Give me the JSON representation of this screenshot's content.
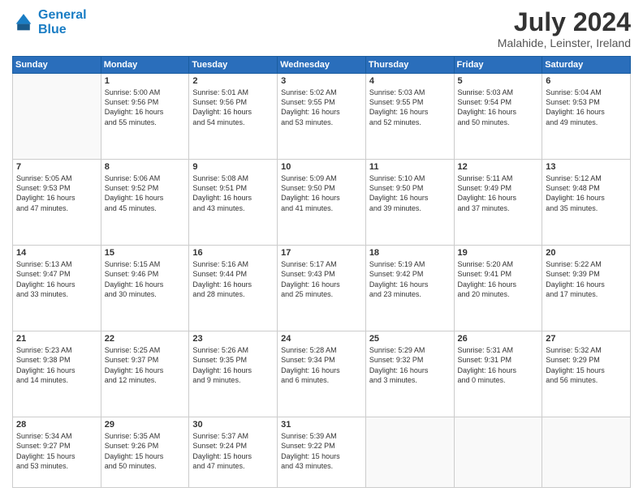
{
  "header": {
    "logo_line1": "General",
    "logo_line2": "Blue",
    "month_year": "July 2024",
    "location": "Malahide, Leinster, Ireland"
  },
  "weekdays": [
    "Sunday",
    "Monday",
    "Tuesday",
    "Wednesday",
    "Thursday",
    "Friday",
    "Saturday"
  ],
  "weeks": [
    [
      {
        "day": "",
        "sunrise": "",
        "sunset": "",
        "daylight": ""
      },
      {
        "day": "1",
        "sunrise": "Sunrise: 5:00 AM",
        "sunset": "Sunset: 9:56 PM",
        "daylight": "Daylight: 16 hours and 55 minutes."
      },
      {
        "day": "2",
        "sunrise": "Sunrise: 5:01 AM",
        "sunset": "Sunset: 9:56 PM",
        "daylight": "Daylight: 16 hours and 54 minutes."
      },
      {
        "day": "3",
        "sunrise": "Sunrise: 5:02 AM",
        "sunset": "Sunset: 9:55 PM",
        "daylight": "Daylight: 16 hours and 53 minutes."
      },
      {
        "day": "4",
        "sunrise": "Sunrise: 5:03 AM",
        "sunset": "Sunset: 9:55 PM",
        "daylight": "Daylight: 16 hours and 52 minutes."
      },
      {
        "day": "5",
        "sunrise": "Sunrise: 5:03 AM",
        "sunset": "Sunset: 9:54 PM",
        "daylight": "Daylight: 16 hours and 50 minutes."
      },
      {
        "day": "6",
        "sunrise": "Sunrise: 5:04 AM",
        "sunset": "Sunset: 9:53 PM",
        "daylight": "Daylight: 16 hours and 49 minutes."
      }
    ],
    [
      {
        "day": "7",
        "sunrise": "Sunrise: 5:05 AM",
        "sunset": "Sunset: 9:53 PM",
        "daylight": "Daylight: 16 hours and 47 minutes."
      },
      {
        "day": "8",
        "sunrise": "Sunrise: 5:06 AM",
        "sunset": "Sunset: 9:52 PM",
        "daylight": "Daylight: 16 hours and 45 minutes."
      },
      {
        "day": "9",
        "sunrise": "Sunrise: 5:08 AM",
        "sunset": "Sunset: 9:51 PM",
        "daylight": "Daylight: 16 hours and 43 minutes."
      },
      {
        "day": "10",
        "sunrise": "Sunrise: 5:09 AM",
        "sunset": "Sunset: 9:50 PM",
        "daylight": "Daylight: 16 hours and 41 minutes."
      },
      {
        "day": "11",
        "sunrise": "Sunrise: 5:10 AM",
        "sunset": "Sunset: 9:50 PM",
        "daylight": "Daylight: 16 hours and 39 minutes."
      },
      {
        "day": "12",
        "sunrise": "Sunrise: 5:11 AM",
        "sunset": "Sunset: 9:49 PM",
        "daylight": "Daylight: 16 hours and 37 minutes."
      },
      {
        "day": "13",
        "sunrise": "Sunrise: 5:12 AM",
        "sunset": "Sunset: 9:48 PM",
        "daylight": "Daylight: 16 hours and 35 minutes."
      }
    ],
    [
      {
        "day": "14",
        "sunrise": "Sunrise: 5:13 AM",
        "sunset": "Sunset: 9:47 PM",
        "daylight": "Daylight: 16 hours and 33 minutes."
      },
      {
        "day": "15",
        "sunrise": "Sunrise: 5:15 AM",
        "sunset": "Sunset: 9:46 PM",
        "daylight": "Daylight: 16 hours and 30 minutes."
      },
      {
        "day": "16",
        "sunrise": "Sunrise: 5:16 AM",
        "sunset": "Sunset: 9:44 PM",
        "daylight": "Daylight: 16 hours and 28 minutes."
      },
      {
        "day": "17",
        "sunrise": "Sunrise: 5:17 AM",
        "sunset": "Sunset: 9:43 PM",
        "daylight": "Daylight: 16 hours and 25 minutes."
      },
      {
        "day": "18",
        "sunrise": "Sunrise: 5:19 AM",
        "sunset": "Sunset: 9:42 PM",
        "daylight": "Daylight: 16 hours and 23 minutes."
      },
      {
        "day": "19",
        "sunrise": "Sunrise: 5:20 AM",
        "sunset": "Sunset: 9:41 PM",
        "daylight": "Daylight: 16 hours and 20 minutes."
      },
      {
        "day": "20",
        "sunrise": "Sunrise: 5:22 AM",
        "sunset": "Sunset: 9:39 PM",
        "daylight": "Daylight: 16 hours and 17 minutes."
      }
    ],
    [
      {
        "day": "21",
        "sunrise": "Sunrise: 5:23 AM",
        "sunset": "Sunset: 9:38 PM",
        "daylight": "Daylight: 16 hours and 14 minutes."
      },
      {
        "day": "22",
        "sunrise": "Sunrise: 5:25 AM",
        "sunset": "Sunset: 9:37 PM",
        "daylight": "Daylight: 16 hours and 12 minutes."
      },
      {
        "day": "23",
        "sunrise": "Sunrise: 5:26 AM",
        "sunset": "Sunset: 9:35 PM",
        "daylight": "Daylight: 16 hours and 9 minutes."
      },
      {
        "day": "24",
        "sunrise": "Sunrise: 5:28 AM",
        "sunset": "Sunset: 9:34 PM",
        "daylight": "Daylight: 16 hours and 6 minutes."
      },
      {
        "day": "25",
        "sunrise": "Sunrise: 5:29 AM",
        "sunset": "Sunset: 9:32 PM",
        "daylight": "Daylight: 16 hours and 3 minutes."
      },
      {
        "day": "26",
        "sunrise": "Sunrise: 5:31 AM",
        "sunset": "Sunset: 9:31 PM",
        "daylight": "Daylight: 16 hours and 0 minutes."
      },
      {
        "day": "27",
        "sunrise": "Sunrise: 5:32 AM",
        "sunset": "Sunset: 9:29 PM",
        "daylight": "Daylight: 15 hours and 56 minutes."
      }
    ],
    [
      {
        "day": "28",
        "sunrise": "Sunrise: 5:34 AM",
        "sunset": "Sunset: 9:27 PM",
        "daylight": "Daylight: 15 hours and 53 minutes."
      },
      {
        "day": "29",
        "sunrise": "Sunrise: 5:35 AM",
        "sunset": "Sunset: 9:26 PM",
        "daylight": "Daylight: 15 hours and 50 minutes."
      },
      {
        "day": "30",
        "sunrise": "Sunrise: 5:37 AM",
        "sunset": "Sunset: 9:24 PM",
        "daylight": "Daylight: 15 hours and 47 minutes."
      },
      {
        "day": "31",
        "sunrise": "Sunrise: 5:39 AM",
        "sunset": "Sunset: 9:22 PM",
        "daylight": "Daylight: 15 hours and 43 minutes."
      },
      {
        "day": "",
        "sunrise": "",
        "sunset": "",
        "daylight": ""
      },
      {
        "day": "",
        "sunrise": "",
        "sunset": "",
        "daylight": ""
      },
      {
        "day": "",
        "sunrise": "",
        "sunset": "",
        "daylight": ""
      }
    ]
  ]
}
